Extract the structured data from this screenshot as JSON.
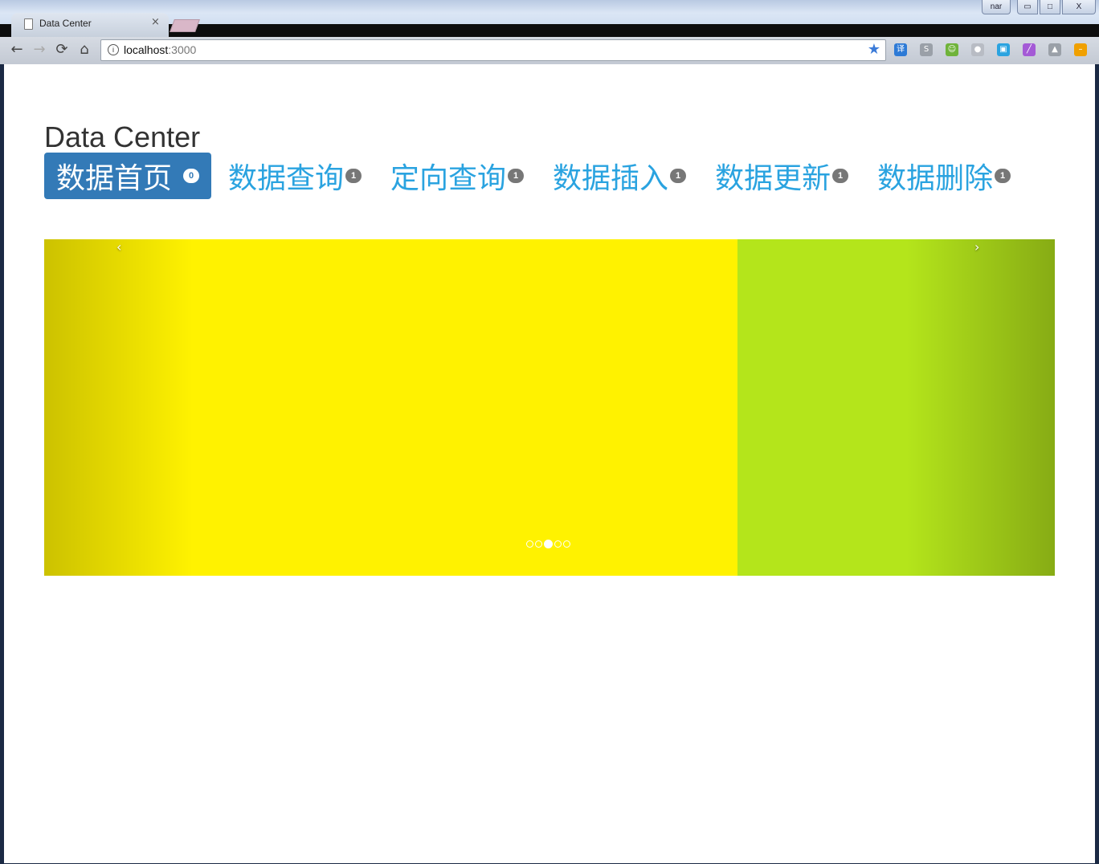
{
  "browser": {
    "tab_title": "Data Center",
    "tab_close": "×",
    "user_button": "nar",
    "minimize": "▭",
    "maximize": "□",
    "close": "X",
    "back": "←",
    "forward": "→",
    "reload": "⟳",
    "home": "⌂",
    "info": "i",
    "url_host": "localhost",
    "url_port": ":3000",
    "bookmark": "★",
    "extensions": [
      {
        "name": "translate-icon",
        "glyph": "译",
        "color": "#2d7ad6"
      },
      {
        "name": "extension-gray-icon",
        "glyph": "S",
        "color": "#9aa0a8"
      },
      {
        "name": "frog-icon",
        "glyph": "☺",
        "color": "#6fb33a"
      },
      {
        "name": "globe-icon",
        "glyph": "●",
        "color": "#b8bcc4"
      },
      {
        "name": "screenshot-icon",
        "glyph": "▣",
        "color": "#2aa3e0"
      },
      {
        "name": "pen-icon",
        "glyph": "╱",
        "color": "#a45ad6"
      },
      {
        "name": "warning-icon",
        "glyph": "▲",
        "color": "#9aa0a8"
      },
      {
        "name": "minus-circle-icon",
        "glyph": "–",
        "color": "#f0a000"
      }
    ]
  },
  "page": {
    "brand": "Data Center",
    "nav": [
      {
        "label": "数据首页",
        "badge": "0",
        "active": true
      },
      {
        "label": "数据查询",
        "badge": "1",
        "active": false
      },
      {
        "label": "定向查询",
        "badge": "1",
        "active": false
      },
      {
        "label": "数据插入",
        "badge": "1",
        "active": false
      },
      {
        "label": "数据更新",
        "badge": "1",
        "active": false
      },
      {
        "label": "数据删除",
        "badge": "1",
        "active": false
      }
    ],
    "carousel": {
      "prev": "‹",
      "next": "›",
      "slide_count": 5,
      "active_index": 2,
      "colors": {
        "current": "#fff200",
        "next": "#b4e51b"
      }
    }
  }
}
